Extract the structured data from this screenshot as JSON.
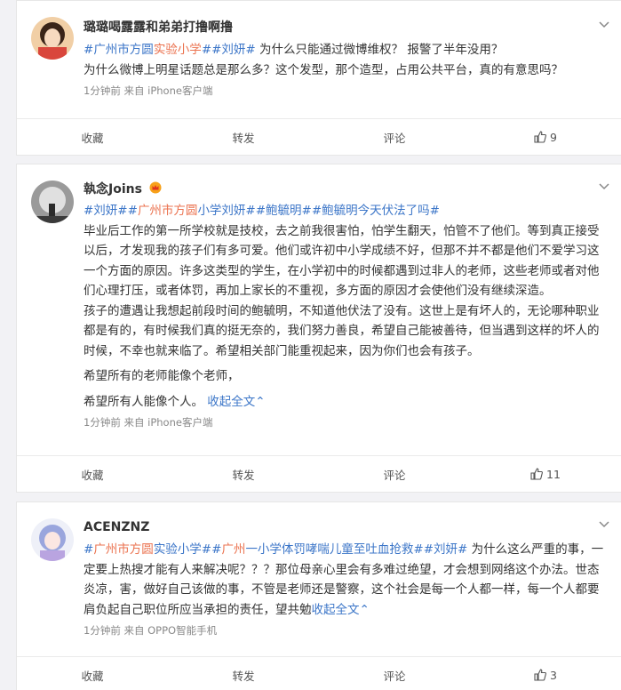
{
  "posts": [
    {
      "username": "璐璐喝露露和弟弟打撸啊撸",
      "tags_line": [
        "#广州市方圆实验小学##刘妍#"
      ],
      "text_after_tags": " 为什么只能通过微博维权？ 报警了半年没用？",
      "paragraphs": [
        "为什么微博上明星话题总是那么多？这个发型，那个造型，占用公共平台，真的有意思吗？"
      ],
      "meta": "1分钟前  来自 iPhone客户端",
      "actions": {
        "collect": "收藏",
        "repost": "转发",
        "comment": "评论",
        "like": "9"
      }
    },
    {
      "username": "執念Joins",
      "tags_text": "#刘妍##广州市方圆小学刘妍##鲍毓明##鲍毓明今天伏法了吗#",
      "paragraphs": [
        "毕业后工作的第一所学校就是技校，去之前我很害怕，怕学生翻天，怕管不了他们。等到真正接受以后，才发现我的孩子们有多可爱。他们或许初中小学成绩不好，但那不并不都是他们不爱学习这一个方面的原因。许多这类型的学生，在小学初中的时候都遇到过非人的老师，这些老师或者对他们心理打压，或者体罚，再加上家长的不重视，多方面的原因才会使他们没有继续深造。",
        "孩子的遭遇让我想起前段时间的鲍毓明，不知道他伏法了没有。这世上是有坏人的，无论哪种职业都是有的，有时候我们真的挺无奈的，我们努力善良，希望自己能被善待，但当遇到这样的坏人的时候，不幸也就来临了。希望相关部门能重视起来，因为你们也会有孩子。",
        "希望所有的老师能像个老师，",
        "希望所有人能像个人。"
      ],
      "expand": "收起全文",
      "meta": "1分钟前  来自 iPhone客户端",
      "actions": {
        "collect": "收藏",
        "repost": "转发",
        "comment": "评论",
        "like": "11"
      }
    },
    {
      "username": "ACENZNZ",
      "tags_text": "#广州市方圆实验小学##广州一小学体罚哮喘儿童至吐血抢救##刘妍#",
      "text_after_tags": " 为什么这么严重的事，一定要上热搜才能有人来解决呢？？？那位母亲心里会有多难过绝望，才会想到网络这个办法。世态炎凉，害，做好自己该做的事，不管是老师还是警察，这个社会是每一个人都一样，每一个人都要肩负起自己职位所应当承担的责任，望共勉",
      "expand": "收起全文",
      "meta": "1分钟前  来自 OPPO智能手机",
      "actions": {
        "collect": "收藏",
        "repost": "转发",
        "comment": "评论",
        "like": "3"
      }
    }
  ],
  "colors": {
    "tag": "#eb7350",
    "link": "#3c76c8",
    "meta": "#888888"
  },
  "icons": [
    "chevron-down-icon",
    "thumbs-up-icon",
    "vip-crown-icon"
  ]
}
